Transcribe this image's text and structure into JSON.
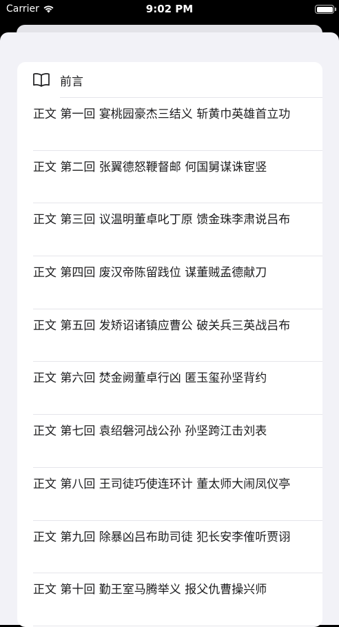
{
  "status": {
    "carrier": "Carrier",
    "time": "9:02 PM"
  },
  "toc": {
    "preface": "前言",
    "chapters": [
      "正文 第一回 宴桃园豪杰三结义 斩黄巾英雄首立功",
      "正文 第二回 张翼德怒鞭督邮 何国舅谋诛宦竖",
      "正文 第三回 议温明董卓叱丁原 馈金珠李肃说吕布",
      "正文 第四回 废汉帝陈留践位 谋董贼孟德献刀",
      "正文 第五回 发矫诏诸镇应曹公 破关兵三英战吕布",
      "正文 第六回 焚金阙董卓行凶 匿玉玺孙坚背约",
      "正文 第七回 袁绍磐河战公孙 孙坚跨江击刘表",
      "正文 第八回 王司徒巧使连环计 董太师大闹凤仪亭",
      "正文 第九回 除暴凶吕布助司徒 犯长安李傕听贾诩",
      "正文 第十回 勤王室马腾举义 报父仇曹操兴师"
    ]
  }
}
